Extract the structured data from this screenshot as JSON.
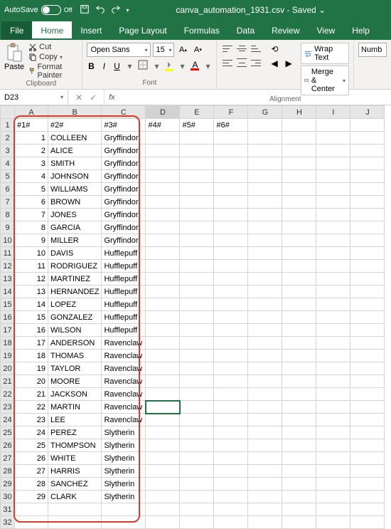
{
  "titlebar": {
    "autosave_label": "AutoSave",
    "autosave_state": "Off",
    "filename": "canva_automation_1931.csv - Saved",
    "filename_chev": "⌄"
  },
  "tabs": [
    "File",
    "Home",
    "Insert",
    "Page Layout",
    "Formulas",
    "Data",
    "Review",
    "View",
    "Help"
  ],
  "active_tab": 1,
  "ribbon": {
    "clipboard": {
      "paste": "Paste",
      "cut": "Cut",
      "copy": "Copy",
      "format_painter": "Format Painter",
      "label": "Clipboard"
    },
    "font": {
      "name": "Open Sans",
      "size": "15",
      "label": "Font"
    },
    "alignment": {
      "wrap": "Wrap Text",
      "merge": "Merge & Center",
      "label": "Alignment"
    },
    "number": {
      "format": "Numb"
    }
  },
  "namebox": "D23",
  "fx": {
    "x": "✕",
    "check": "✓",
    "fx": "fx"
  },
  "columns": [
    "A",
    "B",
    "C",
    "D",
    "E",
    "F",
    "G",
    "H",
    "I",
    "J"
  ],
  "header_row": [
    "#1#",
    "#2#",
    "#3#",
    "#4#",
    "#5#",
    "#6#",
    "",
    "",
    "",
    ""
  ],
  "rows": [
    {
      "n": 1,
      "b": "COLLEEN",
      "c": "Gryffindor"
    },
    {
      "n": 2,
      "b": "ALICE",
      "c": "Gryffindor"
    },
    {
      "n": 3,
      "b": "SMITH",
      "c": "Gryffindor"
    },
    {
      "n": 4,
      "b": "JOHNSON",
      "c": "Gryffindor"
    },
    {
      "n": 5,
      "b": "WILLIAMS",
      "c": "Gryffindor"
    },
    {
      "n": 6,
      "b": "BROWN",
      "c": "Gryffindor"
    },
    {
      "n": 7,
      "b": "JONES",
      "c": "Gryffindor"
    },
    {
      "n": 8,
      "b": "GARCIA",
      "c": "Gryffindor"
    },
    {
      "n": 9,
      "b": "MILLER",
      "c": "Gryffindor"
    },
    {
      "n": 10,
      "b": "DAVIS",
      "c": "Hufflepuff"
    },
    {
      "n": 11,
      "b": "RODRIGUEZ",
      "c": "Hufflepuff"
    },
    {
      "n": 12,
      "b": "MARTINEZ",
      "c": "Hufflepuff"
    },
    {
      "n": 13,
      "b": "HERNANDEZ",
      "c": "Hufflepuff"
    },
    {
      "n": 14,
      "b": "LOPEZ",
      "c": "Hufflepuff"
    },
    {
      "n": 15,
      "b": "GONZALEZ",
      "c": "Hufflepuff"
    },
    {
      "n": 16,
      "b": "WILSON",
      "c": "Hufflepuff"
    },
    {
      "n": 17,
      "b": "ANDERSON",
      "c": "Ravenclaw"
    },
    {
      "n": 18,
      "b": "THOMAS",
      "c": "Ravenclaw"
    },
    {
      "n": 19,
      "b": "TAYLOR",
      "c": "Ravenclaw"
    },
    {
      "n": 20,
      "b": "MOORE",
      "c": "Ravenclaw"
    },
    {
      "n": 21,
      "b": "JACKSON",
      "c": "Ravenclaw"
    },
    {
      "n": 22,
      "b": "MARTIN",
      "c": "Ravenclaw"
    },
    {
      "n": 23,
      "b": "LEE",
      "c": "Ravenclaw"
    },
    {
      "n": 24,
      "b": "PEREZ",
      "c": "Slytherin"
    },
    {
      "n": 25,
      "b": "THOMPSON",
      "c": "Slytherin"
    },
    {
      "n": 26,
      "b": "WHITE",
      "c": "Slytherin"
    },
    {
      "n": 27,
      "b": "HARRIS",
      "c": "Slytherin"
    },
    {
      "n": 28,
      "b": "SANCHEZ",
      "c": "Slytherin"
    },
    {
      "n": 29,
      "b": "CLARK",
      "c": "Slytherin"
    }
  ],
  "active_cell": {
    "row": 23,
    "col": "D"
  },
  "total_rows": 32
}
